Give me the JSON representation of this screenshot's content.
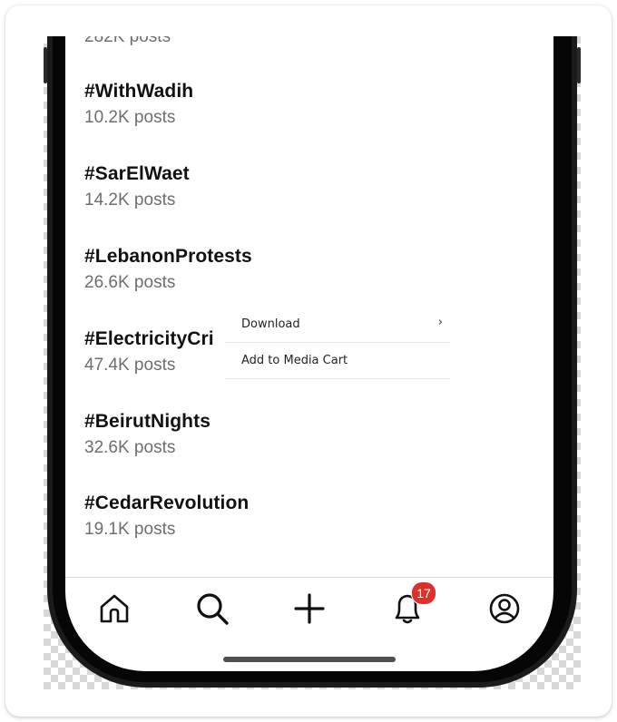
{
  "trends": [
    {
      "tag": "#WithWadih",
      "posts": "10.2K posts"
    },
    {
      "tag": "#SarElWaet",
      "posts": "14.2K posts"
    },
    {
      "tag": "#LebanonProtests",
      "posts": "26.6K posts"
    },
    {
      "tag": "#ElectricityCri",
      "posts": "47.4K posts"
    },
    {
      "tag": "#BeirutNights",
      "posts": "32.6K posts"
    },
    {
      "tag": "#CedarRevolution",
      "posts": "19.1K posts"
    }
  ],
  "partial_top": {
    "posts": "282K posts"
  },
  "context_menu": {
    "download": "Download",
    "download_chevron": "›",
    "add_to_cart": "Add to Media Cart"
  },
  "tabbar": {
    "icons": [
      "home-icon",
      "search-icon",
      "plus-icon",
      "bell-icon",
      "profile-icon"
    ],
    "notification_count": "17",
    "badge_color": "#d8322b"
  }
}
